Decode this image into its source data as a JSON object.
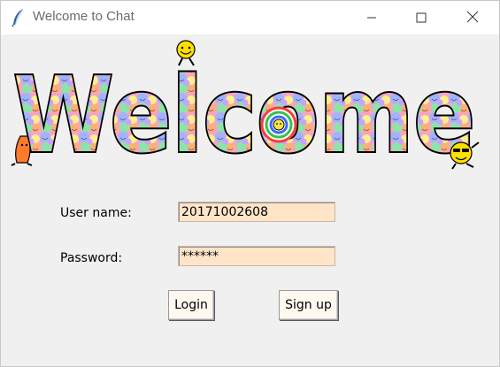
{
  "window": {
    "title": "Welcome to Chat",
    "controls": {
      "minimize": "minimize",
      "maximize": "maximize",
      "close": "close"
    }
  },
  "banner": {
    "text": "Welcome",
    "colors": [
      "#f4a4c8",
      "#9fb4ff",
      "#fff08a",
      "#8de4a8",
      "#ffb070",
      "#c9a2ff"
    ]
  },
  "form": {
    "username_label": "User name:",
    "username_value": "20171002608",
    "password_label": "Password:",
    "password_value": "******",
    "field_bg": "#ffe4c8"
  },
  "buttons": {
    "login_label": "Login",
    "signup_label": "Sign up"
  },
  "icons": {
    "app": "feather-icon",
    "minimize": "minimize-icon",
    "maximize": "maximize-icon",
    "close": "close-icon"
  }
}
